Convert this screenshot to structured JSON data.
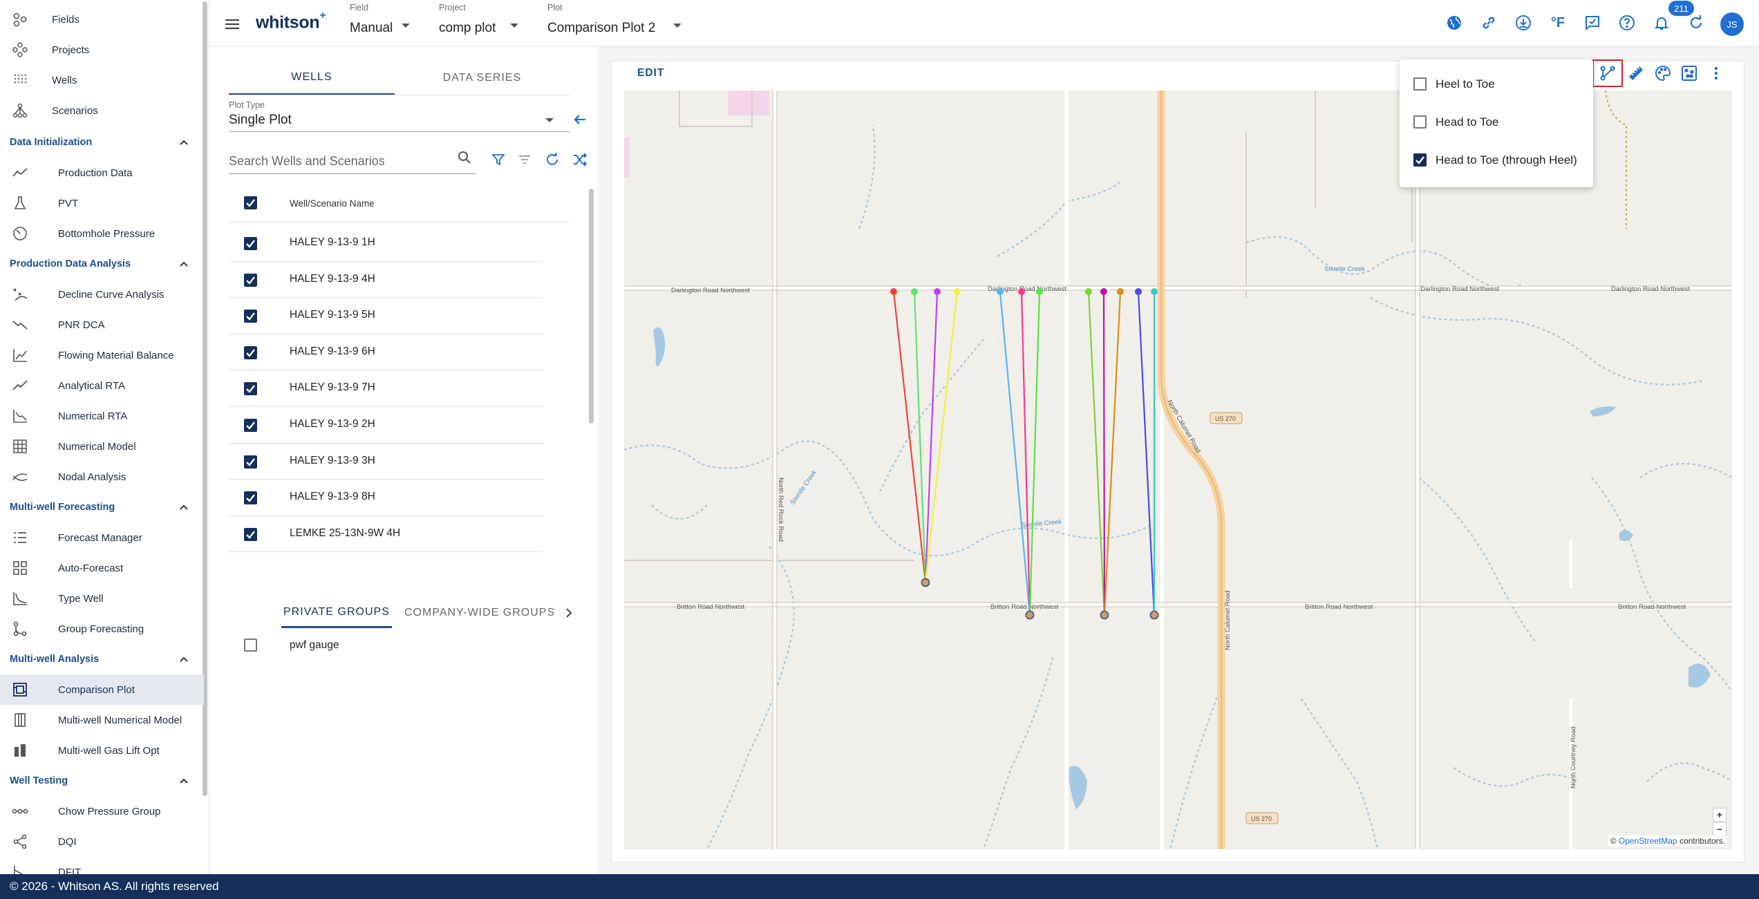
{
  "app": {
    "logo": "whitson",
    "logo_sup": "+"
  },
  "header": {
    "field": {
      "caption": "Field",
      "value": "Manual"
    },
    "project": {
      "caption": "Project",
      "value": "comp plot"
    },
    "plot": {
      "caption": "Plot",
      "value": "Comparison Plot 2"
    },
    "temperature_unit": "°F",
    "notification_count": "211",
    "user_initials": "JS"
  },
  "sidebar": {
    "top_items": [
      {
        "label": "Fields",
        "icon": "fields-icon"
      },
      {
        "label": "Projects",
        "icon": "projects-icon"
      },
      {
        "label": "Wells",
        "icon": "wells-icon"
      },
      {
        "label": "Scenarios",
        "icon": "scenarios-icon"
      }
    ],
    "sections": [
      {
        "title": "Data Initialization",
        "items": [
          "Production Data",
          "PVT",
          "Bottomhole Pressure"
        ]
      },
      {
        "title": "Production Data Analysis",
        "items": [
          "Decline Curve Analysis",
          "PNR DCA",
          "Flowing Material Balance",
          "Analytical RTA",
          "Numerical RTA",
          "Numerical Model",
          "Nodal Analysis"
        ]
      },
      {
        "title": "Multi-well Forecasting",
        "items": [
          "Forecast Manager",
          "Auto-Forecast",
          "Type Well",
          "Group Forecasting"
        ]
      },
      {
        "title": "Multi-well Analysis",
        "items": [
          "Comparison Plot",
          "Multi-well Numerical Model",
          "Multi-well Gas Lift Opt"
        ]
      },
      {
        "title": "Well Testing",
        "items": [
          "Chow Pressure Group",
          "DQI",
          "DFIT"
        ]
      }
    ],
    "active_item": "Comparison Plot"
  },
  "left_panel": {
    "tabs": [
      "WELLS",
      "DATA SERIES"
    ],
    "active_tab": "WELLS",
    "plot_type": {
      "caption": "Plot Type",
      "value": "Single Plot"
    },
    "search_placeholder": "Search Wells and Scenarios",
    "table_header": "Well/Scenario Name",
    "wells": [
      {
        "name": "HALEY 9-13-9 1H",
        "checked": true
      },
      {
        "name": "HALEY 9-13-9 4H",
        "checked": true
      },
      {
        "name": "HALEY 9-13-9 5H",
        "checked": true
      },
      {
        "name": "HALEY 9-13-9 6H",
        "checked": true
      },
      {
        "name": "HALEY 9-13-9 7H",
        "checked": true
      },
      {
        "name": "HALEY 9-13-9 2H",
        "checked": true
      },
      {
        "name": "HALEY 9-13-9 3H",
        "checked": true
      },
      {
        "name": "HALEY 9-13-9 8H",
        "checked": true
      },
      {
        "name": "LEMKE 25-13N-9W 4H",
        "checked": true
      }
    ],
    "group_tabs": [
      "PRIVATE GROUPS",
      "COMPANY-WIDE GROUPS"
    ],
    "active_group_tab": "PRIVATE GROUPS",
    "groups": [
      {
        "name": "pwf gauge",
        "checked": false
      }
    ]
  },
  "map_card": {
    "edit_label": "EDIT",
    "attribution_prefix": "© ",
    "attribution_link": "OpenStreetMap",
    "attribution_suffix": " contributors.",
    "zoom_in": "+",
    "zoom_out": "−",
    "road_labels": {
      "darlington_1": "Darlington Road Northwest",
      "darlington_2": "Darlington Road Northwest",
      "darlington_3": "Darlington Road Northwest",
      "darlington_4": "Darlington Road Northwest",
      "britton_1": "Britton Road Northwest",
      "britton_2": "Britton Road Northwest",
      "britton_3": "Britton Road Northwest",
      "britton_4": "Britton Road Northwest",
      "calumet_north": "North Calumet Road",
      "calumet_south": "North Calumet Road",
      "red_rock": "North Red Rock Road",
      "courtney": "North Courtney Road",
      "us270_a": "US 270",
      "us270_b": "US 270",
      "sixmile_1": "Sixmile Creek",
      "sixmile_2": "Sixmile Creek",
      "sixmile_3": "Sixmile Creek"
    },
    "well_path_colors": [
      "#e8463c",
      "#5fe26f",
      "#c040f0",
      "#f0f040",
      "#5bb4ee",
      "#ee3c8c",
      "#59e04c",
      "#7bd33b",
      "#c0169e",
      "#d4901a",
      "#4a4ae8",
      "#3cc8c0"
    ]
  },
  "well_path_menu": {
    "options": [
      {
        "label": "Heel to Toe",
        "checked": false
      },
      {
        "label": "Head to Toe",
        "checked": false
      },
      {
        "label": "Head to Toe (through Heel)",
        "checked": true
      }
    ]
  },
  "footer": {
    "text": "© 2026 - Whitson AS. All rights reserved"
  }
}
